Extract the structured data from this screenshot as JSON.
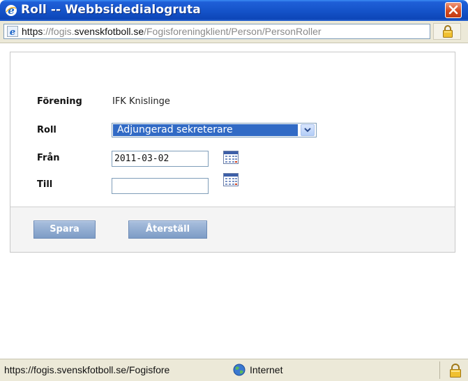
{
  "window": {
    "title": "Roll -- Webbsidedialogruta"
  },
  "address": {
    "url_scheme": "https",
    "url_sep": "://fogis.",
    "url_host": "svenskfotboll.se",
    "url_path": "/Fogisforeningklient/Person/PersonRoller"
  },
  "form": {
    "forening_label": "Förening",
    "forening_value": "IFK Knislinge",
    "roll_label": "Roll",
    "roll_selected": "Adjungerad sekreterare",
    "fran_label": "Från",
    "fran_value": "2011-03-02",
    "till_label": "Till",
    "till_value": ""
  },
  "buttons": {
    "save_label": "Spara",
    "reset_label": "Återställ"
  },
  "status": {
    "url": "https://fogis.svenskfotboll.se/Fogisfore",
    "zone": "Internet"
  },
  "colors": {
    "titlebar": "#1452c8",
    "select_highlight": "#316ac5",
    "button": "#8fa9cf"
  }
}
